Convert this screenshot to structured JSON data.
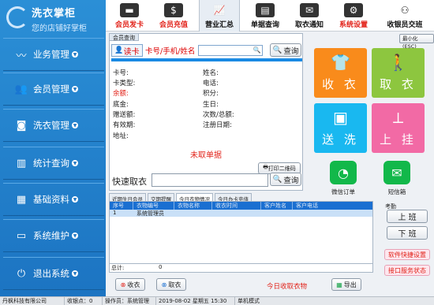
{
  "app": {
    "title_line1": "洗衣掌柜",
    "title_line2": "您的店铺好掌柜"
  },
  "sidebar": {
    "items": [
      {
        "label": "业务管理",
        "icon": "trend-chart-icon"
      },
      {
        "label": "会员管理",
        "icon": "members-icon"
      },
      {
        "label": "洗衣管理",
        "icon": "washing-machine-icon"
      },
      {
        "label": "统计查询",
        "icon": "bar-chart-icon"
      },
      {
        "label": "基础资料",
        "icon": "calendar-icon"
      },
      {
        "label": "系统维护",
        "icon": "monitor-icon"
      },
      {
        "label": "退出系统",
        "icon": "power-icon"
      }
    ]
  },
  "toolbar": {
    "items": [
      {
        "label": "会员发卡",
        "icon": "card-icon"
      },
      {
        "label": "会员充值",
        "icon": "money-icon"
      },
      {
        "label": "营业汇总",
        "icon": "line-chart-icon"
      },
      {
        "label": "单据查询",
        "icon": "document-search-icon"
      },
      {
        "label": "取衣通知",
        "icon": "notify-icon"
      },
      {
        "label": "系统设置",
        "icon": "settings-icon"
      },
      {
        "label": "收银员交班",
        "icon": "cashier-icon"
      }
    ],
    "minimize_label": "最小化(ESC)"
  },
  "member_panel": {
    "tab_label": "会员查询",
    "read_card_label": "读卡",
    "prompt": "卡号/手机/姓名",
    "search_value": "",
    "query_label": "查询",
    "fields_left": [
      "卡号:",
      "卡类型:",
      "余额:",
      "底金:",
      "赠送额:",
      "有效期:",
      "地址:"
    ],
    "fields_right": [
      "姓名:",
      "电话:",
      "积分:",
      "生日:",
      "次数/总额:",
      "注册日期:"
    ],
    "print_qr_label": "打印二维码",
    "unpicked_label": "未取单据"
  },
  "quick_pickup": {
    "label": "快速取衣",
    "value": "",
    "query_label": "查询"
  },
  "tabs": [
    "近期生日会员",
    "交期提醒",
    "今日衣物情况",
    "今日办卡充值"
  ],
  "active_tab": 2,
  "grid": {
    "columns": [
      "序号",
      "衣物编号",
      "衣物名称",
      "收衣时间",
      "客户姓名",
      "客户电话"
    ],
    "row": [
      "1",
      "系统管理员"
    ],
    "total_label": "总计:",
    "total_value": "0"
  },
  "actions": {
    "receive_label": "收衣",
    "pickup_label": "取衣",
    "today_label": "今日收取衣物",
    "export_label": "导出"
  },
  "tiles": [
    {
      "label": "收 衣",
      "icon": "clothes-icon",
      "color": "#f98b1b"
    },
    {
      "label": "取 衣",
      "icon": "pickup-person-icon",
      "color": "#8dc63f"
    },
    {
      "label": "送 洗",
      "icon": "washer-icon",
      "color": "#19b8f0"
    },
    {
      "label": "上 挂",
      "icon": "hanger-icon",
      "color": "#f26aa5"
    }
  ],
  "small_apps": [
    {
      "label": "微信订单",
      "icon": "wechat-icon"
    },
    {
      "label": "短信箱",
      "icon": "sms-icon"
    }
  ],
  "attendance": {
    "label": "考勤",
    "clock_in": "上 班",
    "clock_out": "下 班"
  },
  "links": {
    "shortcut": "软件快捷设置",
    "service_status": "接口服务状态"
  },
  "status_bar": {
    "company": "丹枫科技有限公司",
    "received": "收银点：0",
    "operator": "操作员：系统管理员",
    "datetime": "2019-08-02 星期五 15:30",
    "mode": "单机模式"
  },
  "colors": {
    "sidebar": "#1c74c2",
    "accent_red": "#e2231a",
    "table_header": "#1a6fd1"
  }
}
